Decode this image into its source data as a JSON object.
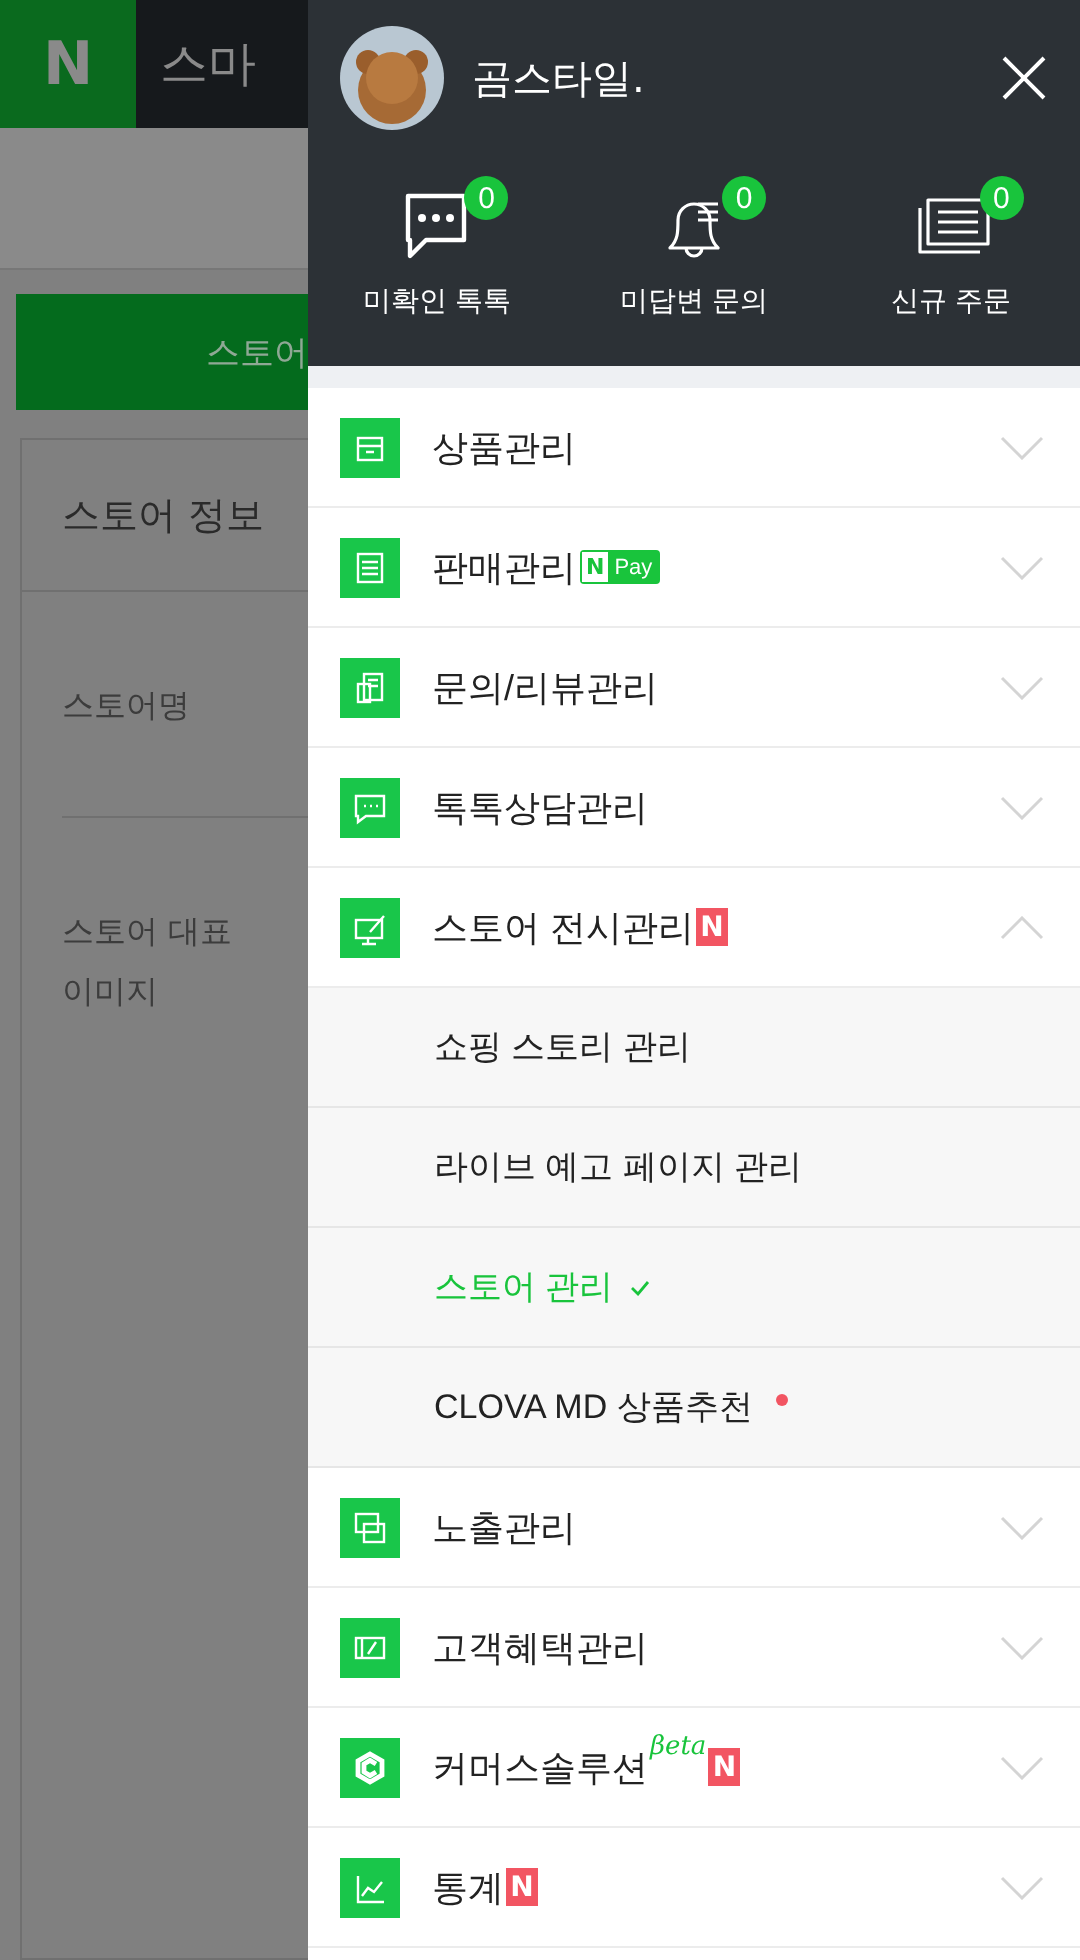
{
  "background_page": {
    "logo": "N",
    "title": "스마",
    "button": "스토어",
    "card": {
      "title": "스토어 정보",
      "fields": [
        "스토어명",
        "스토어 대표 이미지"
      ]
    }
  },
  "drawer": {
    "profile": {
      "name": "곰스타일."
    },
    "stats": [
      {
        "kind": "chat",
        "count": "0",
        "label": "미확인 톡톡"
      },
      {
        "kind": "bell",
        "count": "0",
        "label": "미답변 문의"
      },
      {
        "kind": "orders",
        "count": "0",
        "label": "신규 주문"
      }
    ],
    "menu": [
      {
        "kind": "box",
        "label": "상품관리",
        "expanded": false
      },
      {
        "kind": "list",
        "label": "판매관리",
        "expanded": false,
        "badges": [
          {
            "kind": "npay",
            "mark": "N",
            "text": "Pay"
          }
        ]
      },
      {
        "kind": "review",
        "label": "문의/리뷰관리",
        "expanded": false
      },
      {
        "kind": "chat",
        "label": "톡톡상담관리",
        "expanded": false
      },
      {
        "kind": "display",
        "label": "스토어 전시관리",
        "expanded": true,
        "badges": [
          {
            "kind": "new",
            "text": "N"
          }
        ],
        "children": [
          {
            "label": "쇼핑 스토리 관리",
            "selected": false,
            "dot": false
          },
          {
            "label": "라이브 예고 페이지 관리",
            "selected": false,
            "dot": false
          },
          {
            "label": "스토어 관리",
            "selected": true,
            "dot": false
          },
          {
            "label": "CLOVA MD 상품추천",
            "selected": false,
            "dot": true
          }
        ]
      },
      {
        "kind": "exposure",
        "label": "노출관리",
        "expanded": false
      },
      {
        "kind": "coupon",
        "label": "고객혜택관리",
        "expanded": false
      },
      {
        "kind": "solution",
        "label": "커머스솔루션",
        "expanded": false,
        "badges": [
          {
            "kind": "beta",
            "text": "βeta"
          },
          {
            "kind": "new",
            "text": "N"
          }
        ]
      },
      {
        "kind": "stats",
        "label": "통계",
        "expanded": false,
        "badges": [
          {
            "kind": "new",
            "text": "N"
          }
        ]
      }
    ]
  }
}
